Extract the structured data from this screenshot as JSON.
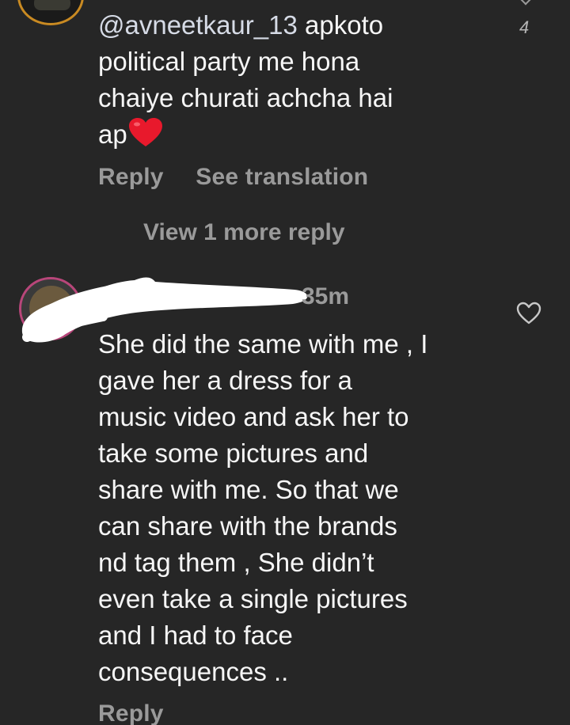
{
  "comment_1": {
    "mention": "@avneetkaur_13",
    "text_lines": [
      " apkoto",
      "political party me hona",
      "chaiye churati achcha hai",
      "ap"
    ],
    "emoji_icon": "red-heart-emoji",
    "like_count": "4",
    "actions": {
      "reply": "Reply",
      "see_translation": "See translation"
    },
    "view_more_replies": "View 1 more reply"
  },
  "comment_2": {
    "timestamp": "35m",
    "like_icon": "heart-outline-icon",
    "text_lines": [
      "She did the same with me , I",
      "gave her a dress for a",
      "music video and ask her to",
      "take some pictures and",
      "share with me. So that we",
      "can share with the brands",
      "nd tag them , She didn’t",
      "even take a single pictures",
      "and I had to face",
      "consequences .."
    ],
    "actions": {
      "reply": "Reply"
    }
  },
  "colors": {
    "background": "#262626",
    "text_primary": "#f6f6f6",
    "text_secondary": "#9a9a9a",
    "heart_emoji": "#e8192c"
  }
}
